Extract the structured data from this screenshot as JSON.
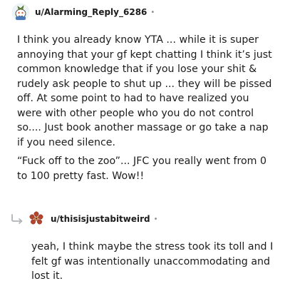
{
  "parent_comment": {
    "author": "u/Alarming_Reply_6286",
    "separator": "•",
    "avatar_icon": "snoo-avatar-icon",
    "paragraphs": [
      "I think you already know YTA ... while it is super annoying that your gf kept chatting I think it’s just common knowledge that if you lose your shit & rudely ask people to shut up ... they will be pissed off. At some point to had to have realized you were with other people who you do not control so.... Just book another massage or go take a nap if you need silence.",
      "“Fuck off to the zoo”... JFC you really went from 0 to 100 pretty fast. Wow!!"
    ]
  },
  "reply_comment": {
    "author": "u/thisisjustabitweird",
    "separator": "•",
    "reply_icon": "reply-arrow-icon",
    "avatar_icon": "flower-avatar-icon",
    "paragraphs": [
      "yeah, I think maybe the stress took its toll and I felt gf was intentionally unaccommodating and lost it."
    ]
  },
  "colors": {
    "text": "#1c1c1c",
    "meta": "#878a8c",
    "reply_arrow": "#b0b3b5",
    "avatar_flower": "#b5442e"
  }
}
